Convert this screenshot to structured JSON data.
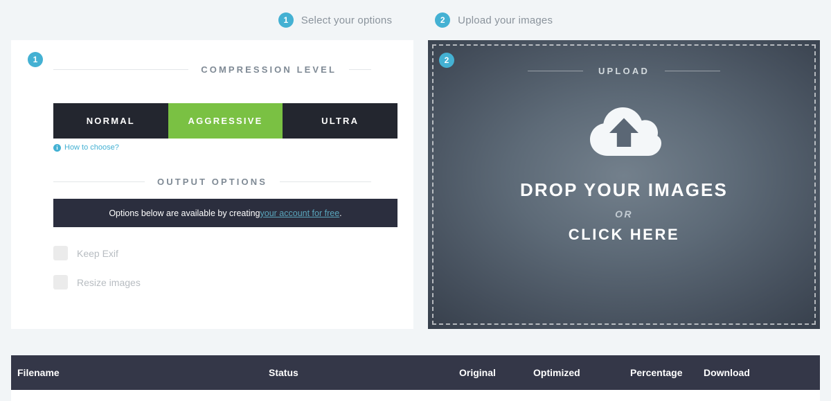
{
  "steps": [
    {
      "number": "1",
      "label": "Select your options"
    },
    {
      "number": "2",
      "label": "Upload your images"
    }
  ],
  "options_panel": {
    "badge": "1",
    "compression": {
      "section_title": "COMPRESSION LEVEL",
      "levels": [
        {
          "label": "NORMAL",
          "active": false
        },
        {
          "label": "AGGRESSIVE",
          "active": true
        },
        {
          "label": "ULTRA",
          "active": false
        }
      ],
      "help_icon": "info-icon",
      "help_label": "How to choose?"
    },
    "output": {
      "section_title": "OUTPUT OPTIONS",
      "notice_prefix": "Options below are available by creating ",
      "notice_link": "your account for free",
      "notice_suffix": ".",
      "checkboxes": [
        {
          "label": "Keep Exif",
          "checked": false
        },
        {
          "label": "Resize images",
          "checked": false
        }
      ]
    }
  },
  "upload_panel": {
    "badge": "2",
    "section_title": "UPLOAD",
    "icon": "cloud-upload-icon",
    "drop_title": "DROP YOUR IMAGES",
    "or_text": "OR",
    "click_here": "CLICK HERE"
  },
  "results_table": {
    "columns": [
      "Filename",
      "Status",
      "Original",
      "Optimized",
      "Percentage",
      "Download"
    ],
    "rows": []
  },
  "colors": {
    "accent_blue": "#44b1d3",
    "accent_green": "#7ac143",
    "dark": "#23262f",
    "notice_dark": "#2b2e3e",
    "table_header": "#343748",
    "page_bg": "#f2f5f7",
    "link": "#5aa6bd"
  }
}
